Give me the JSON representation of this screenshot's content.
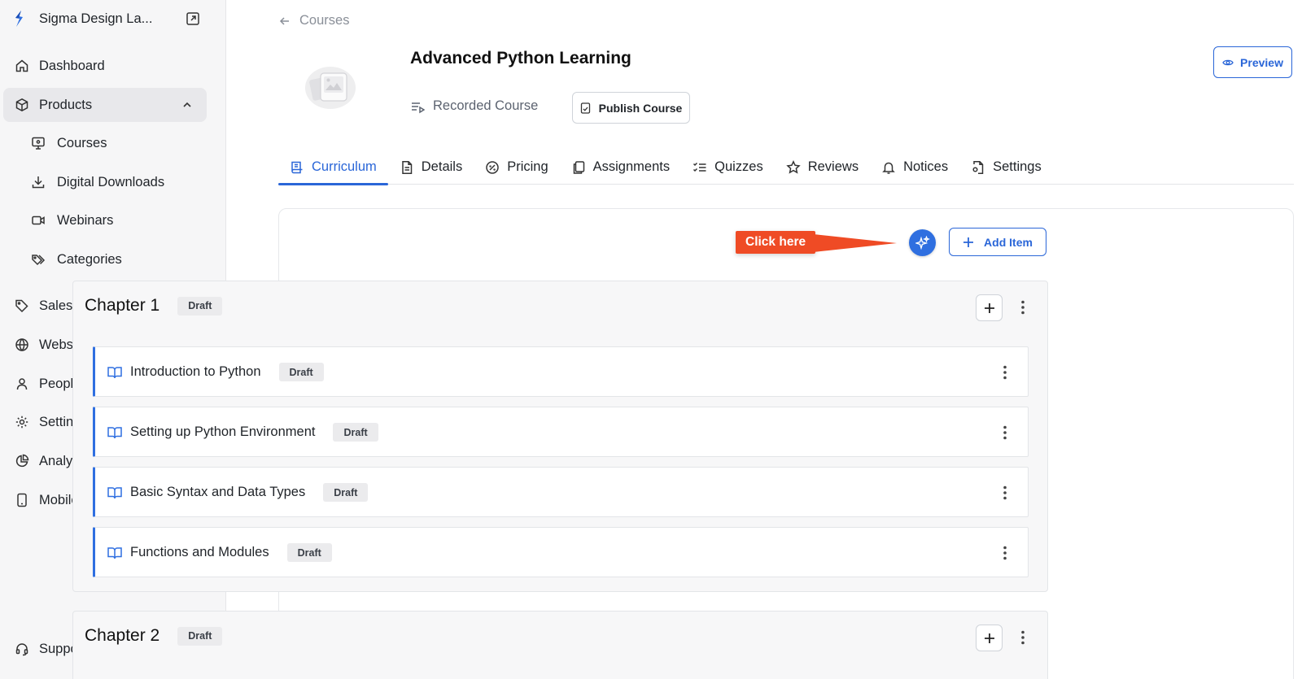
{
  "sidebar": {
    "brand": "Sigma Design La...",
    "items": [
      {
        "label": "Dashboard"
      },
      {
        "label": "Products"
      },
      {
        "label": "Sales"
      },
      {
        "label": "Website"
      },
      {
        "label": "People"
      },
      {
        "label": "Settings"
      },
      {
        "label": "Analytics"
      },
      {
        "label": "Mobile Apps"
      }
    ],
    "products_sub": [
      {
        "label": "Courses"
      },
      {
        "label": "Digital Downloads"
      },
      {
        "label": "Webinars"
      },
      {
        "label": "Categories"
      }
    ],
    "support": "Support"
  },
  "header": {
    "back_label": "Courses",
    "course_title": "Advanced Python Learning",
    "course_type": "Recorded Course",
    "publish_label": "Publish Course",
    "preview_label": "Preview"
  },
  "tabs": [
    {
      "label": "Curriculum"
    },
    {
      "label": "Details"
    },
    {
      "label": "Pricing"
    },
    {
      "label": "Assignments"
    },
    {
      "label": "Quizzes"
    },
    {
      "label": "Reviews"
    },
    {
      "label": "Notices"
    },
    {
      "label": "Settings"
    }
  ],
  "toolbar": {
    "callout": "Click here",
    "add_item_label": "Add Item"
  },
  "chapters": [
    {
      "title": "Chapter 1",
      "status": "Draft",
      "lessons": [
        {
          "title": "Introduction to Python",
          "status": "Draft"
        },
        {
          "title": "Setting up Python Environment",
          "status": "Draft"
        },
        {
          "title": "Basic Syntax and Data Types",
          "status": "Draft"
        },
        {
          "title": "Functions and Modules",
          "status": "Draft"
        }
      ]
    },
    {
      "title": "Chapter 2",
      "status": "Draft",
      "lessons": []
    }
  ],
  "colors": {
    "accent": "#2a66d8",
    "callout": "#ef4b25",
    "sidebar_bg": "#f6f6f7"
  }
}
